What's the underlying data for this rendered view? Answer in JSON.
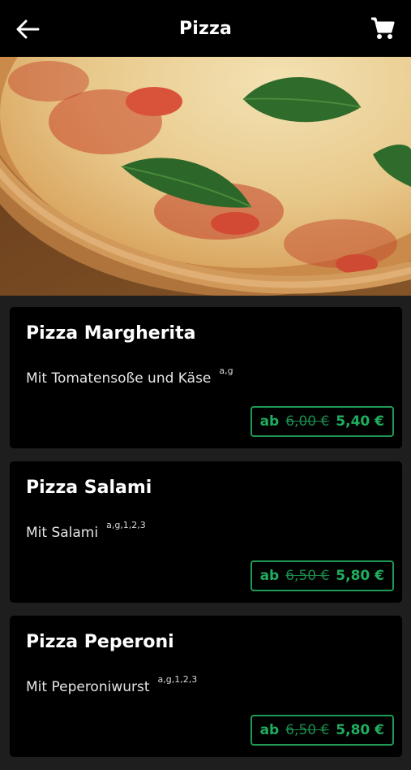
{
  "header": {
    "title": "Pizza"
  },
  "icons": {
    "back": "arrow-left-icon",
    "cart": "shopping-cart-icon"
  },
  "colors": {
    "accent": "#1fae60",
    "card_bg": "#000000",
    "page_bg": "#1e1e1e"
  },
  "items": [
    {
      "name": "Pizza Margherita",
      "desc": "Mit Tomatensoße und Käse",
      "allergens": "a,g",
      "prefix": "ab",
      "old_price": "6,00 €",
      "price": "5,40 €"
    },
    {
      "name": "Pizza Salami",
      "desc": "Mit Salami",
      "allergens": "a,g,1,2,3",
      "prefix": "ab",
      "old_price": "6,50 €",
      "price": "5,80 €"
    },
    {
      "name": "Pizza Peperoni",
      "desc": "Mit Peperoniwurst",
      "allergens": "a,g,1,2,3",
      "prefix": "ab",
      "old_price": "6,50 €",
      "price": "5,80 €"
    }
  ]
}
